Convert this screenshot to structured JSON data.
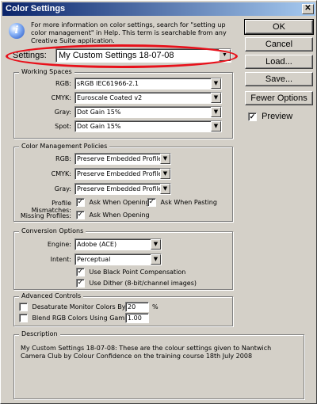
{
  "window": {
    "title": "Color Settings",
    "close_glyph": "✕"
  },
  "info": {
    "icon": "info-icon",
    "text": "For more information on color settings, search for \"setting up color management\" in Help. This term is searchable from any Creative Suite application."
  },
  "settings": {
    "label": "Settings:",
    "value": "My Custom Settings 18-07-08"
  },
  "buttons": {
    "ok": "OK",
    "cancel": "Cancel",
    "load": "Load...",
    "save": "Save...",
    "fewer": "Fewer Options"
  },
  "preview": {
    "label": "Preview",
    "checked": "✓"
  },
  "working_spaces": {
    "title": "Working Spaces",
    "rows": [
      {
        "label": "RGB:",
        "value": "sRGB IEC61966-2.1"
      },
      {
        "label": "CMYK:",
        "value": "Euroscale Coated v2"
      },
      {
        "label": "Gray:",
        "value": "Dot Gain 15%"
      },
      {
        "label": "Spot:",
        "value": "Dot Gain 15%"
      }
    ]
  },
  "color_management": {
    "title": "Color Management Policies",
    "rows": [
      {
        "label": "RGB:",
        "value": "Preserve Embedded Profiles"
      },
      {
        "label": "CMYK:",
        "value": "Preserve Embedded Profiles"
      },
      {
        "label": "Gray:",
        "value": "Preserve Embedded Profiles"
      }
    ],
    "profile_mismatches_label": "Profile Mismatches:",
    "ask_opening": "Ask When Opening",
    "ask_pasting": "Ask When Pasting",
    "missing_profiles_label": "Missing Profiles:",
    "missing_ask_opening": "Ask When Opening",
    "check_glyph": "✓"
  },
  "conversion": {
    "title": "Conversion Options",
    "engine_label": "Engine:",
    "engine_value": "Adobe (ACE)",
    "intent_label": "Intent:",
    "intent_value": "Perceptual",
    "black_point": "Use Black Point Compensation",
    "dither": "Use Dither (8-bit/channel images)",
    "check_glyph": "✓"
  },
  "advanced": {
    "title": "Advanced Controls",
    "desaturate_label": "Desaturate Monitor Colors By:",
    "desaturate_value": "20",
    "desaturate_unit": "%",
    "blend_label": "Blend RGB Colors Using Gamma:",
    "blend_value": "1.00"
  },
  "description": {
    "title": "Description",
    "text": "My Custom Settings 18-07-08:  These are the colour settings given to Nantwich Camera Club by Colour Confidence on the training course 18th July 2008"
  },
  "dropdown_glyph": "▼",
  "colors": {
    "titlebar": "#0a246a",
    "highlight_ellipse": "#e8101a",
    "dialog_bg": "#d4d0c8"
  }
}
